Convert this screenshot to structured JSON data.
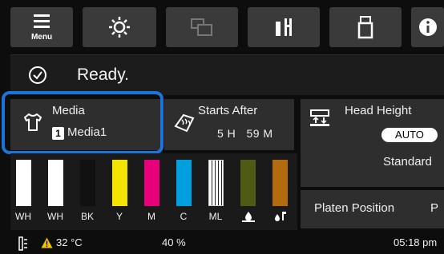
{
  "toolbar": {
    "menu_label": "Menu",
    "buttons": [
      "menu-icon",
      "maintenance-icon",
      "screen-switch-icon",
      "ink-icon",
      "usb-icon",
      "info-icon"
    ]
  },
  "status": {
    "icon": "check-circle-icon",
    "text": "Ready."
  },
  "media": {
    "title": "Media",
    "number": "1",
    "name": "Media1",
    "icon": "t-shirt-icon"
  },
  "starts_after": {
    "title": "Starts After",
    "time": "5 H   59 M",
    "icon": "heater-icon"
  },
  "head_height": {
    "title": "Head Height",
    "auto": "AUTO",
    "value": "Standard",
    "icon": "head-height-icon"
  },
  "platen": {
    "label": "Platen Position",
    "value": "P"
  },
  "inks": [
    {
      "label": "WH",
      "color": "#ffffff",
      "level": 1.0
    },
    {
      "label": "WH",
      "color": "#ffffff",
      "level": 1.0
    },
    {
      "label": "BK",
      "color": "#111111",
      "level": 1.0
    },
    {
      "label": "Y",
      "color": "#f5e400",
      "level": 1.0
    },
    {
      "label": "M",
      "color": "#e6007a",
      "level": 1.0
    },
    {
      "label": "C",
      "color": "#00a0e0",
      "level": 1.0
    },
    {
      "label": "ML",
      "color": "#ffffff",
      "level": 1.0
    },
    {
      "label": "",
      "color": "#4f5a14",
      "level": 1.0
    },
    {
      "label": "",
      "color": "#b36b10",
      "level": 1.0
    }
  ],
  "ink_icons": [
    "waste-ink-icon",
    "cleaning-icon"
  ],
  "environment": {
    "temperature": "32 °C",
    "humidity": "40 %",
    "time": "05:18 pm"
  },
  "colors": {
    "highlight": "#1a74d9",
    "warning": "#f2c200"
  }
}
